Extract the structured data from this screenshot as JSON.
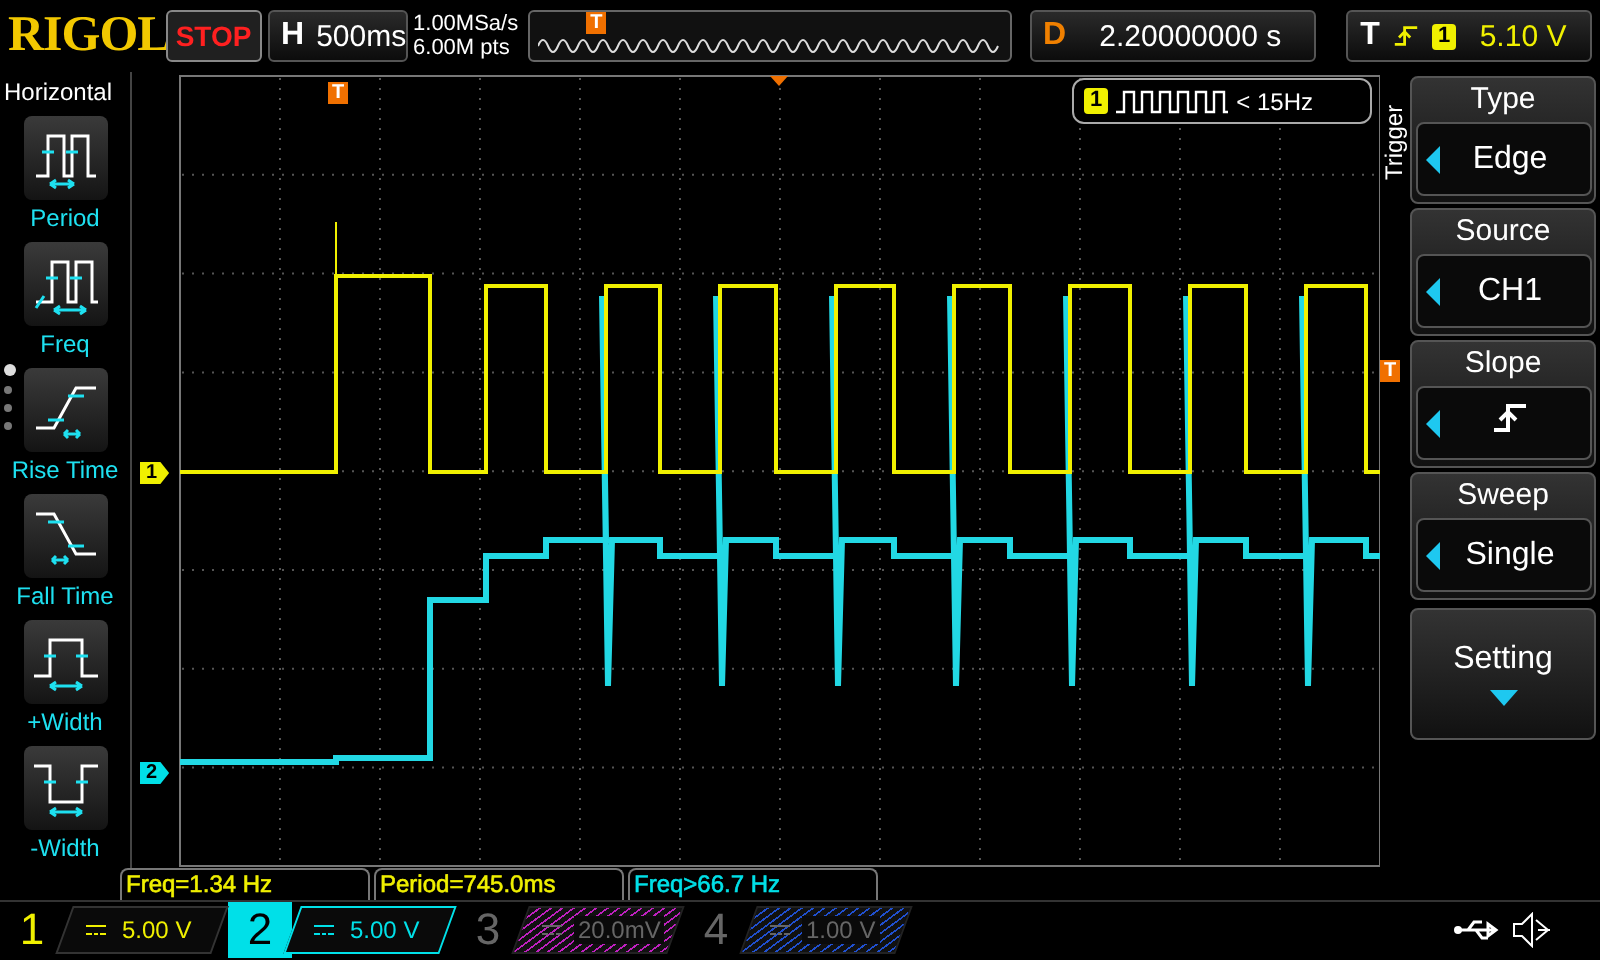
{
  "logo": "RIGOL",
  "run_state": {
    "label": "STOP",
    "kind": "stop"
  },
  "horizontal": {
    "label": "H",
    "timebase": "500ms",
    "sample_rate": "1.00MSa/s",
    "memory_depth": "6.00M pts",
    "trigger_marker": "T"
  },
  "delay": {
    "label": "D",
    "value": "2.20000000 s"
  },
  "trigger_status": {
    "label": "T",
    "source": "1",
    "level": "5.10 V"
  },
  "left_menu": {
    "title": "Horizontal",
    "items": [
      {
        "label": "Period",
        "kind": "period"
      },
      {
        "label": "Freq",
        "kind": "freq"
      },
      {
        "label": "Rise Time",
        "kind": "rise"
      },
      {
        "label": "Fall Time",
        "kind": "fall"
      },
      {
        "label": "+Width",
        "kind": "pwidth"
      },
      {
        "label": "-Width",
        "kind": "nwidth"
      }
    ],
    "pages": [
      {
        "selected": true
      },
      {
        "selected": false
      },
      {
        "selected": false
      },
      {
        "selected": false
      }
    ]
  },
  "display": {
    "trigger_top_marker": "T",
    "trigger_level_marker": "T",
    "channel_markers": [
      {
        "label": "1",
        "color": "#f0f000"
      },
      {
        "label": "2",
        "color": "#00e0e8"
      }
    ],
    "counter": {
      "channel": "1",
      "reading": "< 15Hz"
    }
  },
  "trigger_menu": {
    "title": "Trigger",
    "items": [
      {
        "title": "Type",
        "kind": "text",
        "value": "Edge"
      },
      {
        "title": "Source",
        "kind": "text",
        "value": "CH1"
      },
      {
        "title": "Slope",
        "kind": "rising_edge"
      },
      {
        "title": "Sweep",
        "kind": "text",
        "value": "Single"
      }
    ],
    "more": "Setting"
  },
  "measurements": [
    {
      "text": "Freq=1.34 Hz",
      "color": "#f0f000"
    },
    {
      "text": "Period=745.0ms",
      "color": "#f0f000"
    },
    {
      "text": "Freq>66.7 Hz",
      "color": "#00e0e8"
    }
  ],
  "channels": [
    {
      "number": "1",
      "scale": "5.00 V",
      "on": true,
      "selected": false,
      "color": "#f0f000"
    },
    {
      "number": "2",
      "scale": "5.00 V",
      "on": true,
      "selected": true,
      "color": "#00e0e8"
    },
    {
      "number": "3",
      "scale": "20.0mV",
      "on": false,
      "selected": false,
      "color": "#c020c0"
    },
    {
      "number": "4",
      "scale": "1.00 V",
      "on": false,
      "selected": false,
      "color": "#2050d0"
    }
  ]
}
